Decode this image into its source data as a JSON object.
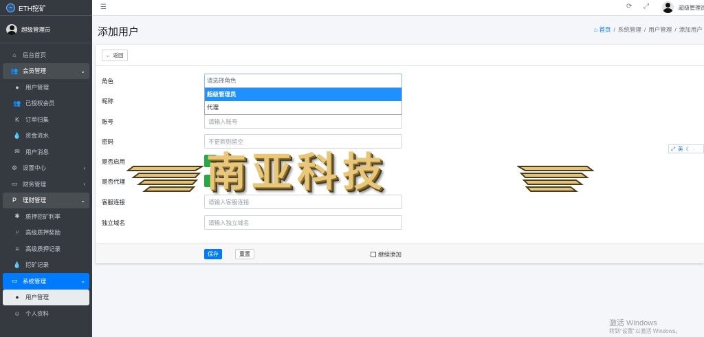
{
  "brand": {
    "title": "ETH挖矿"
  },
  "user_panel": {
    "name": "超级管理员"
  },
  "sidebar": {
    "items": [
      {
        "label": "后台首页",
        "icon": "home-icon",
        "type": "top"
      },
      {
        "label": "会员管理",
        "icon": "users-icon",
        "type": "open"
      },
      {
        "label": "用户管理",
        "icon": "user-icon",
        "type": "sub"
      },
      {
        "label": "已授权会员",
        "icon": "users-icon",
        "type": "sub"
      },
      {
        "label": "订单归集",
        "icon": "k-icon",
        "type": "sub"
      },
      {
        "label": "资金流水",
        "icon": "drop-icon",
        "type": "sub"
      },
      {
        "label": "用户消息",
        "icon": "envelope-icon",
        "type": "sub"
      },
      {
        "label": "设置中心",
        "icon": "cogs-icon",
        "type": "top"
      },
      {
        "label": "财务管理",
        "icon": "card-icon",
        "type": "top"
      },
      {
        "label": "理财管理",
        "icon": "paypal-icon",
        "type": "open"
      },
      {
        "label": "质押挖矿利率",
        "icon": "bug-icon",
        "type": "sub"
      },
      {
        "label": "高级质押奖励",
        "icon": "branch-icon",
        "type": "sub"
      },
      {
        "label": "高级质押记录",
        "icon": "list-icon",
        "type": "sub"
      },
      {
        "label": "挖矿记录",
        "icon": "drop-icon",
        "type": "sub"
      },
      {
        "label": "系统管理",
        "icon": "desktop-icon",
        "type": "active"
      },
      {
        "label": "用户管理",
        "icon": "user-icon",
        "type": "sub-active"
      },
      {
        "label": "个人资料",
        "icon": "smile-icon",
        "type": "sub"
      }
    ]
  },
  "topbar": {
    "user": "超级管理员"
  },
  "header": {
    "title": "添加用户",
    "breadcrumb": [
      "首页",
      "系统管理",
      "用户管理",
      "添加用户"
    ]
  },
  "card": {
    "back_label": "返回"
  },
  "form": {
    "role": {
      "label": "角色",
      "placeholder": "请选择角色",
      "options": [
        "超级管理员",
        "代理"
      ]
    },
    "nickname": {
      "label": "昵称"
    },
    "account": {
      "label": "账号",
      "placeholder": "请输入账号"
    },
    "password": {
      "label": "密码",
      "placeholder": "不更新则留空"
    },
    "enabled": {
      "label": "是否启用"
    },
    "is_agent": {
      "label": "是否代理"
    },
    "service_link": {
      "label": "客服连接",
      "placeholder": "请输入客服连接"
    },
    "domain": {
      "label": "独立域名",
      "placeholder": "请输入独立域名"
    }
  },
  "footer": {
    "save": "保存",
    "reset": "重置",
    "continue": "继续添加"
  },
  "ime": {
    "lang": "英"
  },
  "watermark": {
    "text": "南亚科技"
  },
  "windows": {
    "activate": "激活 Windows",
    "hint": "转到\"设置\"以激活 Windows。"
  },
  "colors": {
    "sidebar": "#343a40",
    "accent": "#007bff",
    "toggle": "#28a745",
    "watermark": "#e9c77a"
  }
}
